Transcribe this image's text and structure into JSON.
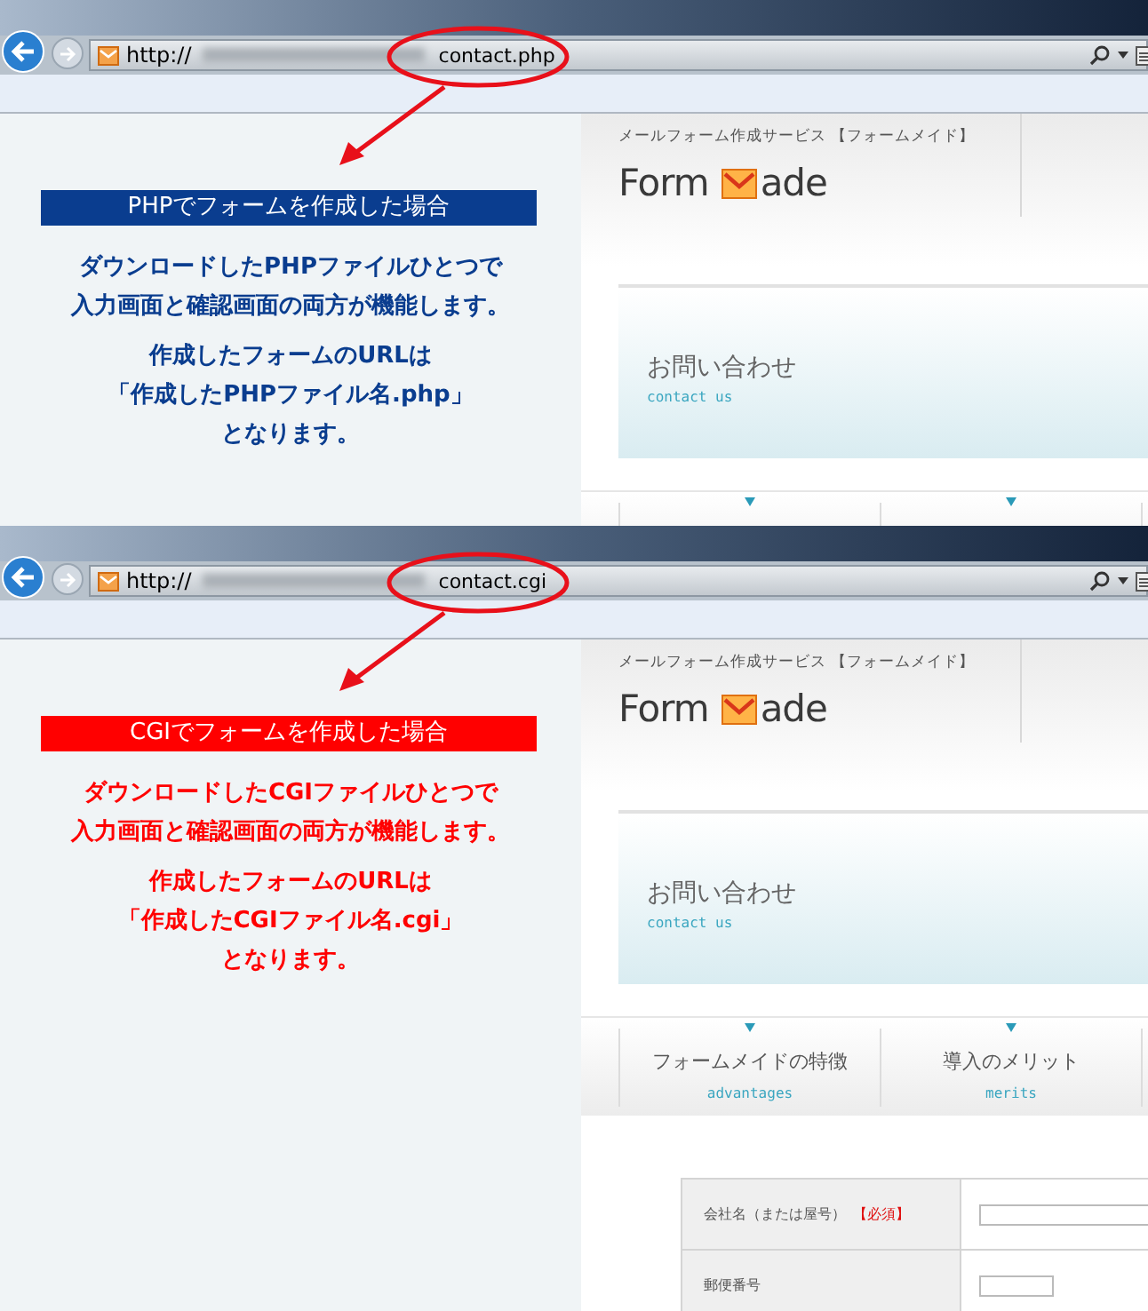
{
  "panels": [
    {
      "address": {
        "scheme": "http://",
        "path": "contact.php"
      },
      "heading": "PHPでフォームを作成した場合",
      "color": "#0a3d8f",
      "description": [
        [
          "ダウンロードしたPHPファイルひとつで",
          "入力画面と確認画面の両方が機能します。"
        ],
        [
          "作成したフォームのURLは",
          "「作成したPHPファイル名.php」",
          "となります。"
        ]
      ],
      "site": {
        "tagline": "メールフォーム作成サービス 【フォームメイド】",
        "logo_start": "Form",
        "logo_end": "ade",
        "contact_title": "お問い合わせ",
        "contact_sub": "contact us"
      }
    },
    {
      "address": {
        "scheme": "http://",
        "path": "contact.cgi"
      },
      "heading": "CGIでフォームを作成した場合",
      "color": "#ff0000",
      "description": [
        [
          "ダウンロードしたCGIファイルひとつで",
          "入力画面と確認画面の両方が機能します。"
        ],
        [
          "作成したフォームのURLは",
          "「作成したCGIファイル名.cgi」",
          "となります。"
        ]
      ],
      "site": {
        "tagline": "メールフォーム作成サービス 【フォームメイド】",
        "logo_start": "Form",
        "logo_end": "ade",
        "contact_title": "お問い合わせ",
        "contact_sub": "contact us",
        "nav": [
          {
            "label": "フォームメイドの特徴",
            "sub": "advantages"
          },
          {
            "label": "導入のメリット",
            "sub": "merits"
          }
        ],
        "form_rows": [
          {
            "label": "会社名（または屋号）",
            "required": "【必須】",
            "kind": "wide"
          },
          {
            "label": "郵便番号",
            "kind": "short"
          }
        ]
      }
    }
  ]
}
